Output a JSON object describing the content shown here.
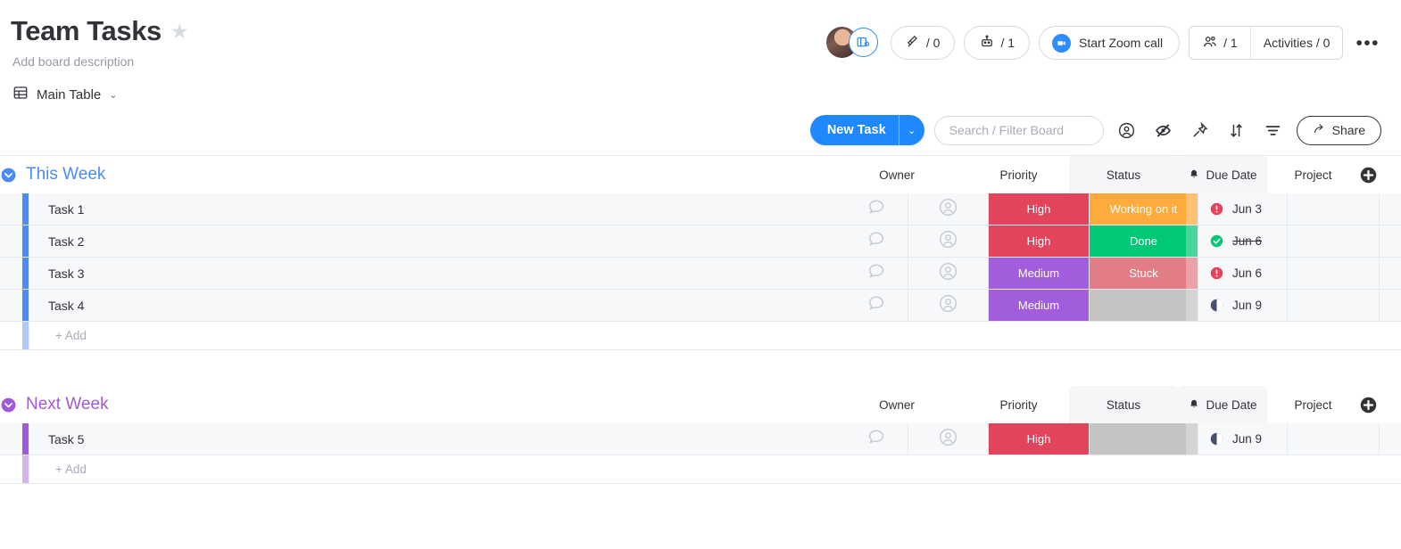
{
  "header": {
    "title": "Team Tasks",
    "star_icon": "star-icon",
    "description_placeholder": "Add board description",
    "avatar": "user-avatar",
    "view_badge_icon": "board-view-eye-icon",
    "integrations": {
      "icon": "plug-integration-icon",
      "count": "/ 0"
    },
    "automations": {
      "icon": "robot-automation-icon",
      "count": "/ 1"
    },
    "zoom_call": {
      "icon": "zoom-camera-icon",
      "label": "Start Zoom call"
    },
    "members": {
      "icon": "people-icon",
      "count": "/ 1"
    },
    "activities": {
      "label": "Activities / 0"
    },
    "more_menu": "•••"
  },
  "view": {
    "icon": "table-view-icon",
    "label": "Main Table",
    "chevron": "⌄"
  },
  "toolbar": {
    "new_task_label": "New Task",
    "new_task_chevron": "⌄",
    "search_placeholder": "Search / Filter Board",
    "person_icon": "person-circle-icon",
    "hide_icon": "eye-off-icon",
    "pin_icon": "pin-icon",
    "sort_icon": "sort-icon",
    "filter_icon": "filter-funnel-icon",
    "share_icon": "share-arrow-icon",
    "share_label": "Share"
  },
  "columns": [
    {
      "label": "Owner"
    },
    {
      "label": "Priority"
    },
    {
      "label": "Status"
    },
    {
      "label": "Due Date",
      "icon": "bell-icon"
    },
    {
      "label": "Project"
    }
  ],
  "add_column_icon": "add-column-plus-icon",
  "add_row_label": "+ Add",
  "colors": {
    "group_this_week": "#4b8bf4",
    "group_next_week": "#a259d9",
    "priority_high": "#e2445c",
    "priority_medium": "#a25ddc",
    "status_working": "#fdab3d",
    "status_done": "#00c875",
    "status_stuck": "#e27d85",
    "status_empty": "#c4c4c4",
    "due_overdue": "#e2445c",
    "due_done": "#00c875",
    "due_upcoming": "#474f72",
    "accent_blue": "#1f88fe"
  },
  "groups": [
    {
      "name": "This Week",
      "color": "#4b8bf4",
      "collapse_icon": "collapse-chevron-icon",
      "rows": [
        {
          "name": "Task 1",
          "chat_icon": "conversation-bubble-icon",
          "owner_icon": "owner-avatar-placeholder",
          "priority": "High",
          "priority_color": "#e2445c",
          "status": "Working on it",
          "status_color": "#fdab3d",
          "due": "Jun 3",
          "due_state": "overdue",
          "due_struck": false,
          "project": ""
        },
        {
          "name": "Task 2",
          "chat_icon": "conversation-bubble-icon",
          "owner_icon": "owner-avatar-placeholder",
          "priority": "High",
          "priority_color": "#e2445c",
          "status": "Done",
          "status_color": "#00c875",
          "due": "Jun 6",
          "due_state": "done",
          "due_struck": true,
          "project": ""
        },
        {
          "name": "Task 3",
          "chat_icon": "conversation-bubble-icon",
          "owner_icon": "owner-avatar-placeholder",
          "priority": "Medium",
          "priority_color": "#a25ddc",
          "status": "Stuck",
          "status_color": "#e27d85",
          "due": "Jun 6",
          "due_state": "overdue",
          "due_struck": false,
          "project": ""
        },
        {
          "name": "Task 4",
          "chat_icon": "conversation-bubble-icon",
          "owner_icon": "owner-avatar-placeholder",
          "priority": "Medium",
          "priority_color": "#a25ddc",
          "status": "",
          "status_color": "#c4c4c4",
          "due": "Jun 9",
          "due_state": "upcoming",
          "due_struck": false,
          "project": ""
        }
      ]
    },
    {
      "name": "Next Week",
      "color": "#a259d9",
      "collapse_icon": "collapse-chevron-icon",
      "rows": [
        {
          "name": "Task 5",
          "chat_icon": "conversation-bubble-icon",
          "owner_icon": "owner-avatar-placeholder",
          "priority": "High",
          "priority_color": "#e2445c",
          "status": "",
          "status_color": "#c4c4c4",
          "due": "Jun 9",
          "due_state": "upcoming",
          "due_struck": false,
          "project": ""
        }
      ]
    }
  ]
}
